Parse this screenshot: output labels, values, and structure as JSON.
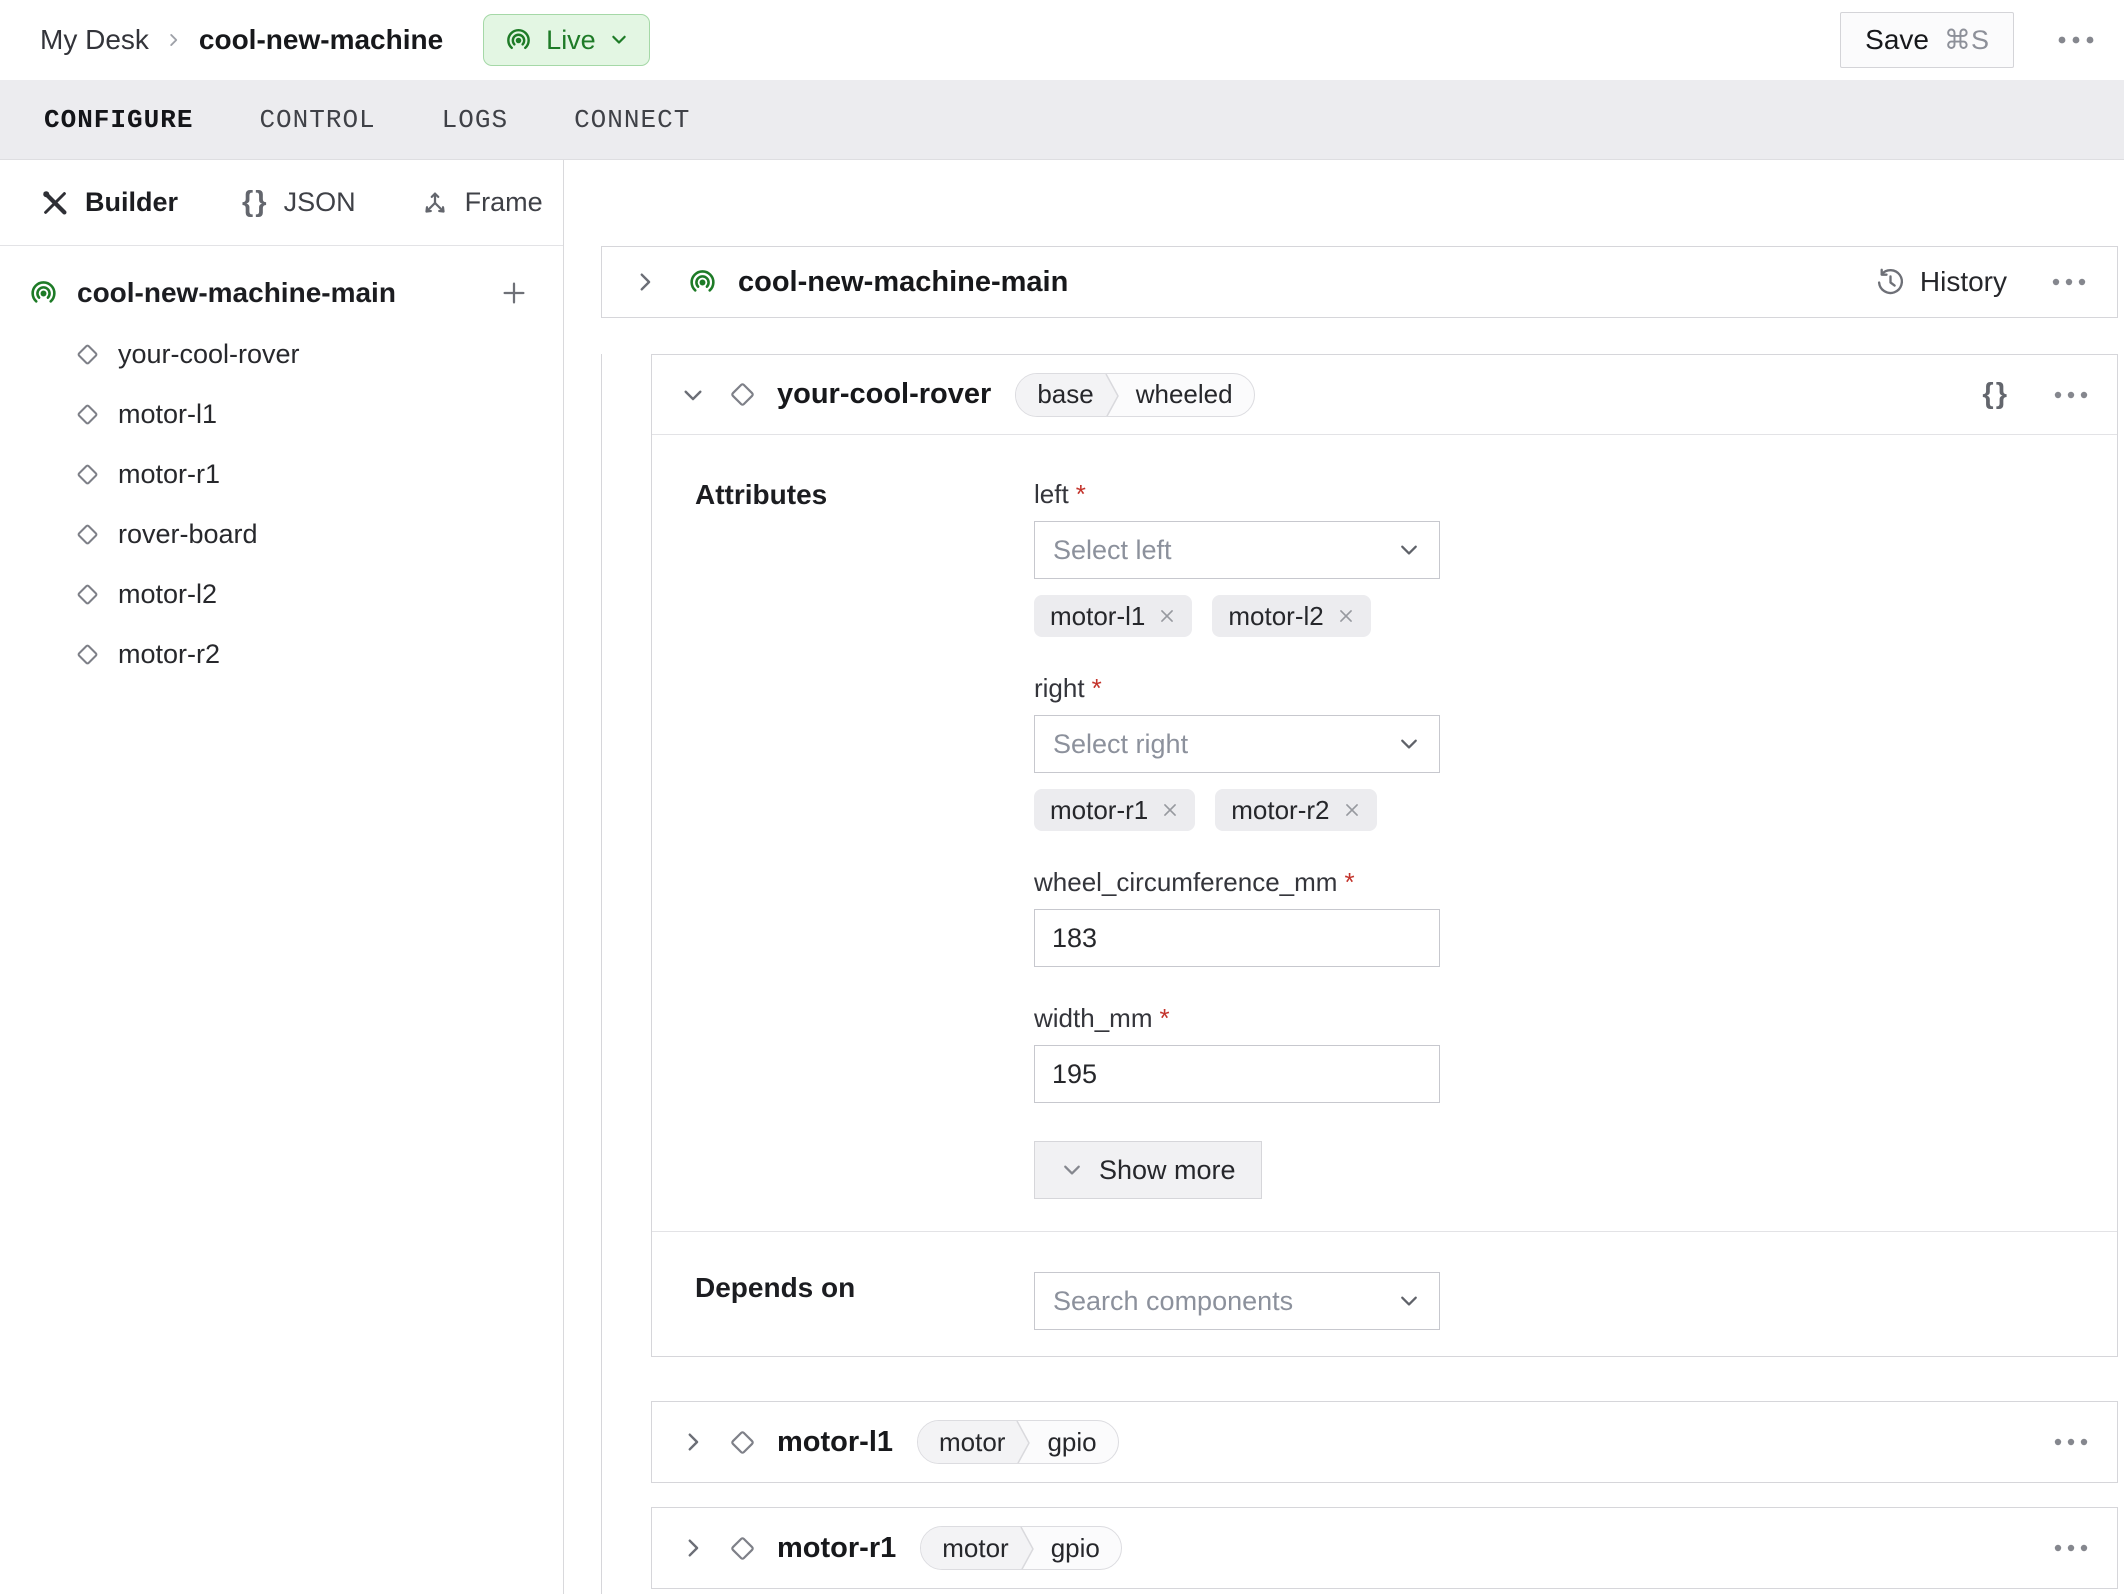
{
  "colors": {
    "accent_green": "#1e7b27",
    "live_badge_bg": "#e3f6e3",
    "live_badge_border": "#a5d8a7",
    "required_red": "#c3332b",
    "tabbar_bg": "#ececef"
  },
  "ui": {
    "required_marker": "*",
    "braces_glyph": "{}"
  },
  "topbar": {
    "breadcrumb": {
      "parent": "My Desk",
      "current": "cool-new-machine"
    },
    "live_badge": {
      "label": "Live",
      "icon": "live-broadcast-icon"
    },
    "save_button": {
      "label": "Save",
      "shortcut": "⌘S"
    }
  },
  "tabs": [
    {
      "label": "CONFIGURE",
      "active": true
    },
    {
      "label": "CONTROL",
      "active": false
    },
    {
      "label": "LOGS",
      "active": false
    },
    {
      "label": "CONNECT",
      "active": false
    }
  ],
  "sidebar": {
    "modes": [
      {
        "label": "Builder",
        "icon": "tools-icon",
        "active": true
      },
      {
        "label": "JSON",
        "icon": "braces-icon",
        "active": false
      },
      {
        "label": "Frame",
        "icon": "frame-axes-icon",
        "active": false
      }
    ],
    "tree": {
      "root": {
        "label": "cool-new-machine-main",
        "icon": "machine-part-icon"
      },
      "children": [
        "your-cool-rover",
        "motor-l1",
        "motor-r1",
        "rover-board",
        "motor-l2",
        "motor-r2"
      ]
    }
  },
  "main": {
    "part_card": {
      "title": "cool-new-machine-main",
      "history_label": "History"
    },
    "rover_card": {
      "title": "your-cool-rover",
      "tags": [
        "base",
        "wheeled"
      ],
      "attributes_label": "Attributes",
      "fields": {
        "left": {
          "label": "left",
          "placeholder": "Select left",
          "chips": [
            "motor-l1",
            "motor-l2"
          ]
        },
        "right": {
          "label": "right",
          "placeholder": "Select right",
          "chips": [
            "motor-r1",
            "motor-r2"
          ]
        },
        "wheel_circumference_mm": {
          "label": "wheel_circumference_mm",
          "value": "183"
        },
        "width_mm": {
          "label": "width_mm",
          "value": "195"
        }
      },
      "show_more_label": "Show more",
      "depends_on": {
        "label": "Depends on",
        "placeholder": "Search components"
      }
    },
    "motor_cards": [
      {
        "title": "motor-l1",
        "tags": [
          "motor",
          "gpio"
        ]
      },
      {
        "title": "motor-r1",
        "tags": [
          "motor",
          "gpio"
        ]
      }
    ]
  }
}
